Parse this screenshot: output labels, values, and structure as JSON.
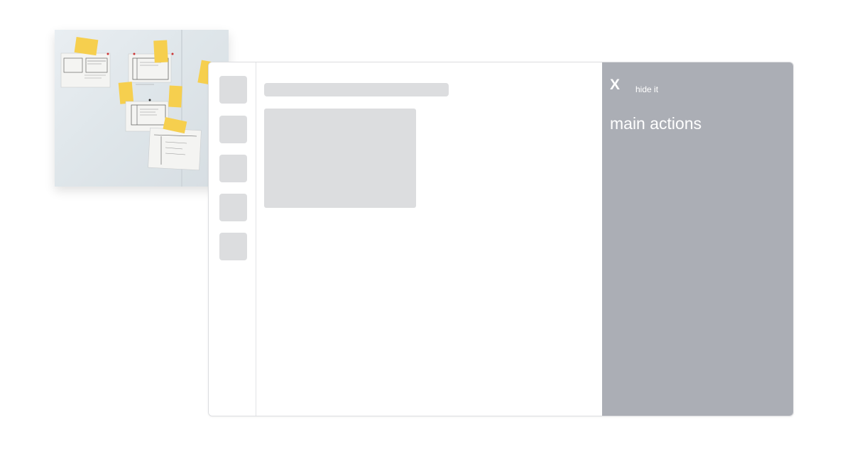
{
  "photo": {
    "description_icon": "paper-prototype-photo"
  },
  "rail": {
    "buttons": [
      "rail-button-1",
      "rail-button-2",
      "rail-button-3",
      "rail-button-4",
      "rail-button-5"
    ]
  },
  "panel": {
    "close_label": "X",
    "hide_label": "hide it",
    "title": "main actions"
  },
  "colors": {
    "panel_background": "#abaeb5",
    "placeholder_gray": "#dcdddf",
    "sticky_note": "#f6cf4e"
  }
}
